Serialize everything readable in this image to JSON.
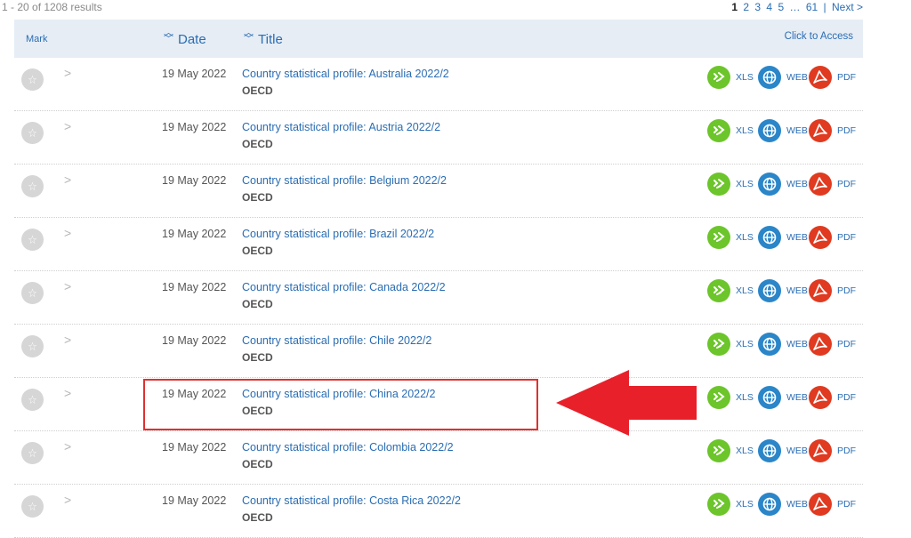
{
  "results": {
    "count_label": "1 - 20 of 1208 results",
    "pager": {
      "current": "1",
      "pages": [
        "2",
        "3",
        "4",
        "5",
        "…",
        "61"
      ],
      "separator": "|",
      "next": "Next >"
    }
  },
  "table_header": {
    "mark": "Mark",
    "date": "Date",
    "title": "Title",
    "access": "Click to Access"
  },
  "access_labels": {
    "xls": "XLS",
    "web": "WEB",
    "pdf": "PDF"
  },
  "icons": {
    "mark": "star-icon",
    "expand": "chevron-right-icon",
    "sort": "sort-arrows-icon",
    "xls": "spreadsheet-icon",
    "web": "globe-icon",
    "pdf": "pdf-icon"
  },
  "colors": {
    "link": "#2a6db3",
    "header_bg": "#e6edf5",
    "xls": "#6cc52a",
    "web": "#2a86c8",
    "pdf": "#e03a20",
    "annotation": "#e03030"
  },
  "rows": [
    {
      "date": "19 May 2022",
      "title": "Country statistical profile: Australia 2022/2",
      "publisher": "OECD"
    },
    {
      "date": "19 May 2022",
      "title": "Country statistical profile: Austria 2022/2",
      "publisher": "OECD"
    },
    {
      "date": "19 May 2022",
      "title": "Country statistical profile: Belgium 2022/2",
      "publisher": "OECD"
    },
    {
      "date": "19 May 2022",
      "title": "Country statistical profile: Brazil 2022/2",
      "publisher": "OECD"
    },
    {
      "date": "19 May 2022",
      "title": "Country statistical profile: Canada 2022/2",
      "publisher": "OECD"
    },
    {
      "date": "19 May 2022",
      "title": "Country statistical profile: Chile 2022/2",
      "publisher": "OECD"
    },
    {
      "date": "19 May 2022",
      "title": "Country statistical profile: China 2022/2",
      "publisher": "OECD"
    },
    {
      "date": "19 May 2022",
      "title": "Country statistical profile: Colombia 2022/2",
      "publisher": "OECD"
    },
    {
      "date": "19 May 2022",
      "title": "Country statistical profile: Costa Rica 2022/2",
      "publisher": "OECD"
    }
  ]
}
